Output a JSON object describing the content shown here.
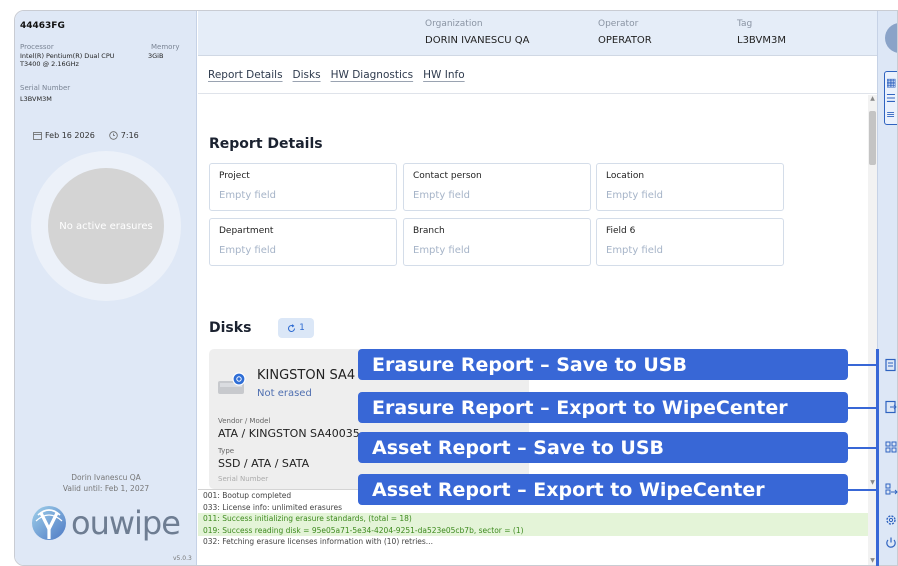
{
  "device": {
    "id": "44463FG",
    "processor_label": "Processor",
    "processor_value_line1": "Intel(R) Pentium(R) Dual CPU",
    "processor_value_line2": "T3400 @ 2.16GHz",
    "memory_label": "Memory",
    "memory_value": "3GiB",
    "serial_label": "Serial Number",
    "serial_value": "L3BVM3M",
    "date": "Feb 16 2026",
    "time": "7:16",
    "erasure_status": "No active erasures"
  },
  "owner": {
    "name": "Dorin Ivanescu QA",
    "valid_until": "Valid until: Feb 1, 2027"
  },
  "brand": {
    "logo_text": "ouwipe",
    "version": "v5.0.3",
    "accent": "#3867d6"
  },
  "header": {
    "organization_label": "Organization",
    "organization_value": "DORIN IVANESCU QA",
    "operator_label": "Operator",
    "operator_value": "OPERATOR",
    "tag_label": "Tag",
    "tag_value": "L3BVM3M"
  },
  "tabs": [
    "Report Details",
    "Disks",
    "HW Diagnostics",
    "HW Info"
  ],
  "report_details": {
    "title": "Report Details",
    "fields": [
      {
        "label": "Project",
        "value": "Empty field"
      },
      {
        "label": "Contact person",
        "value": "Empty field"
      },
      {
        "label": "Location",
        "value": "Empty field"
      },
      {
        "label": "Department",
        "value": "Empty field"
      },
      {
        "label": "Branch",
        "value": "Empty field"
      },
      {
        "label": "Field 6",
        "value": "Empty field"
      }
    ]
  },
  "disks": {
    "title": "Disks",
    "count": "1",
    "card": {
      "name": "KINGSTON SA4",
      "status": "Not erased",
      "vendor_label": "Vendor / Model",
      "vendor_value": "ATA / KINGSTON SA40035",
      "type_label": "Type",
      "type_value": "SSD / ATA / SATA",
      "serial_label": "Serial Number"
    }
  },
  "log": [
    {
      "text": "001: Bootup completed",
      "status": "info"
    },
    {
      "text": "033: License info: unlimited erasures",
      "status": "info"
    },
    {
      "text": "011: Success initializing erasure standards, (total = 18)",
      "status": "ok"
    },
    {
      "text": "019: Success reading disk = 95e05a71-5e34-4204-9251-da523e05cb7b, sector = (1)",
      "status": "ok"
    },
    {
      "text": "032: Fetching erasure licenses information with (10) retries...",
      "status": "info"
    }
  ],
  "callouts": [
    "Erasure Report – Save to USB",
    "Erasure Report – Export to WipeCenter",
    "Asset Report – Save to USB",
    "Asset Report – Export to WipeCenter"
  ]
}
